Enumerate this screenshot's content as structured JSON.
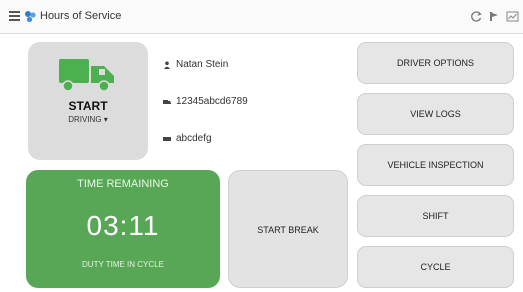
{
  "header": {
    "title": "Hours of Service",
    "icons": [
      "menu-icon",
      "app-icon",
      "refresh-icon",
      "pin-icon",
      "dashboard-icon"
    ]
  },
  "status_card": {
    "state": "START",
    "mode": "DRIVING ▾",
    "icon": "truck-icon"
  },
  "driver_info": {
    "name": "Natan Stein",
    "id": "12345abcd6789",
    "vehicle": "abcdefg"
  },
  "time_card": {
    "title": "TIME REMAINING",
    "value": "03:11",
    "subtitle": "DUTY TIME IN CYCLE"
  },
  "break_button": {
    "label": "START BREAK"
  },
  "menu": [
    {
      "label": "DRIVER OPTIONS"
    },
    {
      "label": "VIEW LOGS"
    },
    {
      "label": "VEHICLE INSPECTION"
    },
    {
      "label": "SHIFT"
    },
    {
      "label": "CYCLE"
    }
  ],
  "colors": {
    "accent_green": "#58a756",
    "truck_green": "#4caf50",
    "card_gray": "#dcdcdc"
  }
}
